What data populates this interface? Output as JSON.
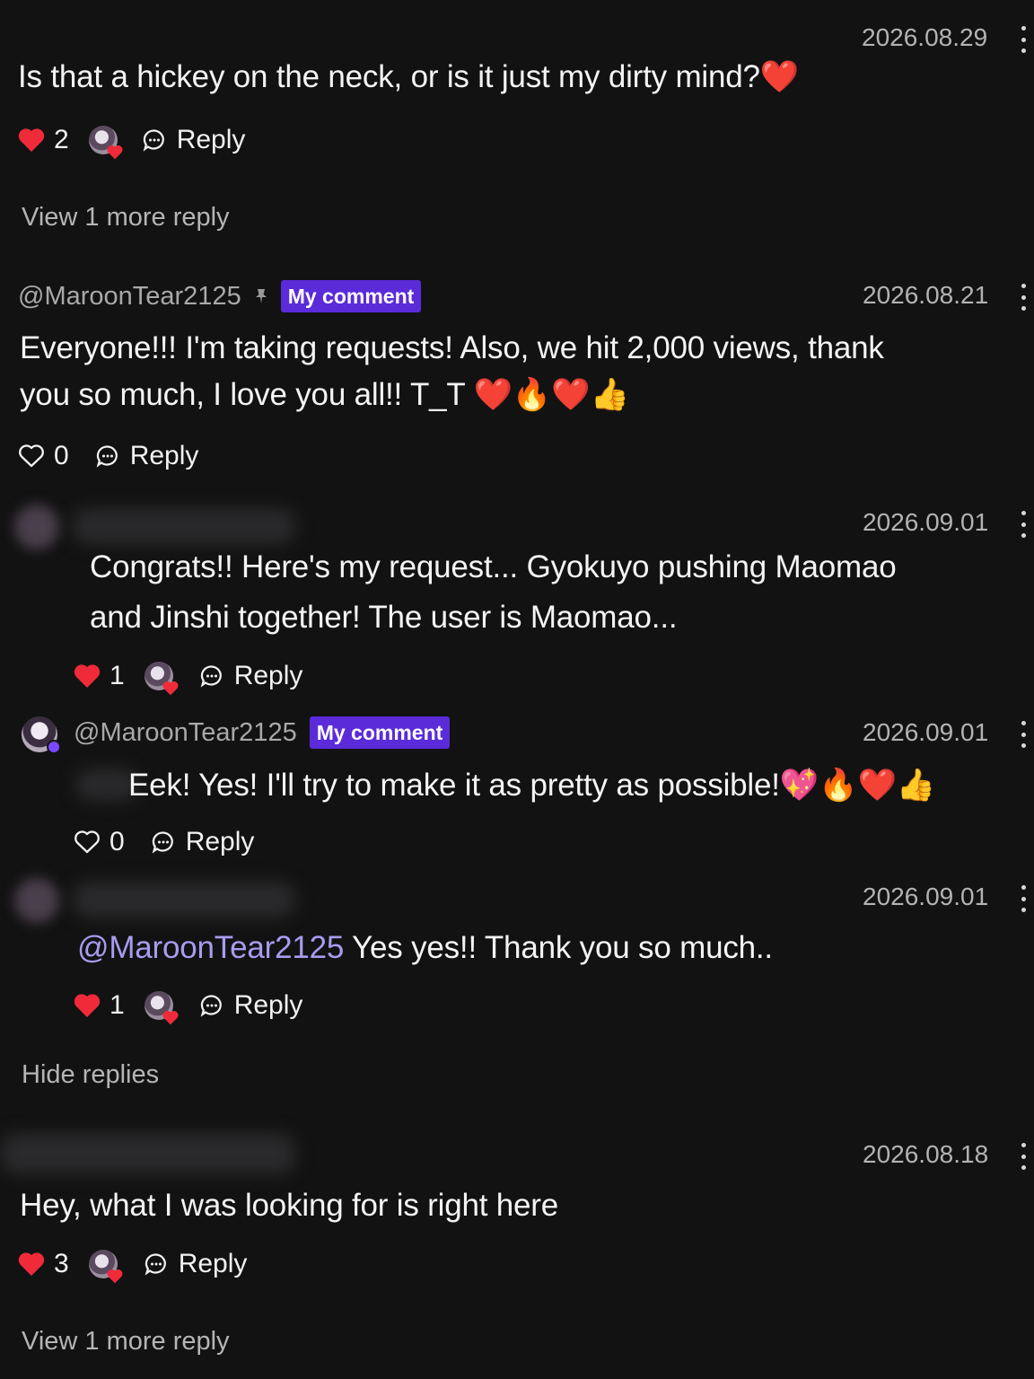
{
  "colors": {
    "background": "#121212",
    "badge": "#5b2bd9",
    "mention": "#a79cf0",
    "heart": "#ef2b3a"
  },
  "comments": [
    {
      "date": "2026.08.29",
      "text": "Is that a hickey on the neck, or is it just my dirty mind?❤️",
      "likes": "2",
      "liked": true,
      "reply_label": "Reply",
      "view_more": "View 1 more reply"
    },
    {
      "username": "@MaroonTear2125",
      "badge": "My comment",
      "date": "2026.08.21",
      "text_line1": "Everyone!!! I'm taking requests! Also, we hit 2,000 views, thank",
      "text_line2": "you so much, I love you all!! T_T ❤️🔥❤️👍",
      "likes": "0",
      "liked": false,
      "reply_label": "Reply"
    },
    {
      "date": "2026.09.01",
      "text_line1": "Congrats!! Here's my request... Gyokuyo pushing Maomao",
      "text_line2": "and Jinshi together! The user is Maomao...",
      "likes": "1",
      "liked": true,
      "reply_label": "Reply"
    },
    {
      "username": "@MaroonTear2125",
      "badge": "My comment",
      "date": "2026.09.01",
      "text": "Eek! Yes! I'll try to make it as pretty as possible!💖🔥❤️👍",
      "likes": "0",
      "liked": false,
      "reply_label": "Reply"
    },
    {
      "date": "2026.09.01",
      "mention": "@MaroonTear2125",
      "text": " Yes yes!! Thank you so much..",
      "likes": "1",
      "liked": true,
      "reply_label": "Reply",
      "hide_replies": "Hide replies"
    },
    {
      "date": "2026.08.18",
      "text": "Hey, what I was looking for is right here",
      "likes": "3",
      "liked": true,
      "reply_label": "Reply",
      "view_more": "View 1 more reply"
    }
  ],
  "icons": {
    "like_filled": "heart-filled-icon",
    "like_outline": "heart-outline-icon",
    "reply": "chat-bubble-icon",
    "more": "kebab-menu-icon",
    "pin": "pin-icon"
  }
}
